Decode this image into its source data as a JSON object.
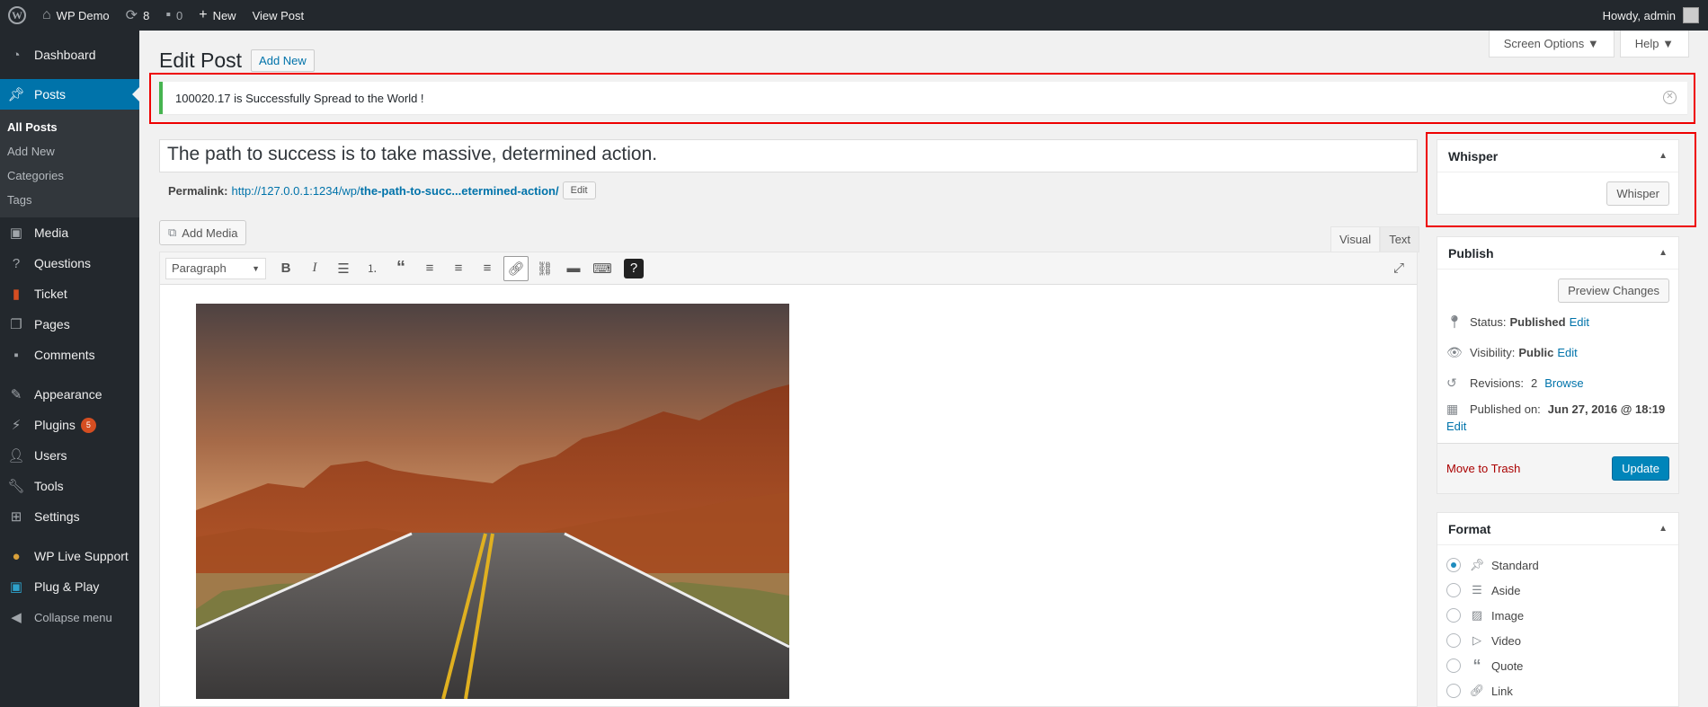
{
  "admin_bar": {
    "site_name": "WP Demo",
    "updates_count": "8",
    "comments_count": "0",
    "new_label": "New",
    "view_post_label": "View Post",
    "howdy": "Howdy, admin"
  },
  "sidebar": {
    "dashboard": "Dashboard",
    "posts": "Posts",
    "posts_sub": [
      "All Posts",
      "Add New",
      "Categories",
      "Tags"
    ],
    "media": "Media",
    "questions": "Questions",
    "ticket": "Ticket",
    "pages": "Pages",
    "comments": "Comments",
    "appearance": "Appearance",
    "plugins": "Plugins",
    "plugins_badge": "5",
    "users": "Users",
    "tools": "Tools",
    "settings": "Settings",
    "wp_live_support": "WP Live Support",
    "plug_play": "Plug & Play",
    "collapse": "Collapse menu"
  },
  "header": {
    "title": "Edit Post",
    "add_new": "Add New",
    "screen_options": "Screen Options ▼",
    "help": "Help ▼"
  },
  "notice": {
    "text": "100020.17 is Successfully Spread to the World !"
  },
  "post": {
    "title": "The path to success is to take massive, determined action.",
    "permalink_label": "Permalink:",
    "permalink_base": "http://127.0.0.1:1234/wp/",
    "permalink_slug": "the-path-to-succ...etermined-action/",
    "permalink_edit": "Edit"
  },
  "editor": {
    "add_media": "Add Media",
    "tab_visual": "Visual",
    "tab_text": "Text",
    "format_select": "Paragraph"
  },
  "whisper_box": {
    "title": "Whisper",
    "button": "Whisper"
  },
  "publish_box": {
    "title": "Publish",
    "preview": "Preview Changes",
    "status_label": "Status:",
    "status_value": "Published",
    "visibility_label": "Visibility:",
    "visibility_value": "Public",
    "revisions_label": "Revisions:",
    "revisions_value": "2",
    "browse": "Browse",
    "published_label": "Published on:",
    "published_value": "Jun 27, 2016 @ 18:19",
    "edit": "Edit",
    "trash": "Move to Trash",
    "update": "Update"
  },
  "format_box": {
    "title": "Format",
    "options": [
      "Standard",
      "Aside",
      "Image",
      "Video",
      "Quote",
      "Link"
    ],
    "selected": "Standard"
  },
  "colors": {
    "accent": "#0073aa",
    "admin_dark": "#23282d",
    "notice_green": "#46b450",
    "highlight_red": "#e00000"
  }
}
